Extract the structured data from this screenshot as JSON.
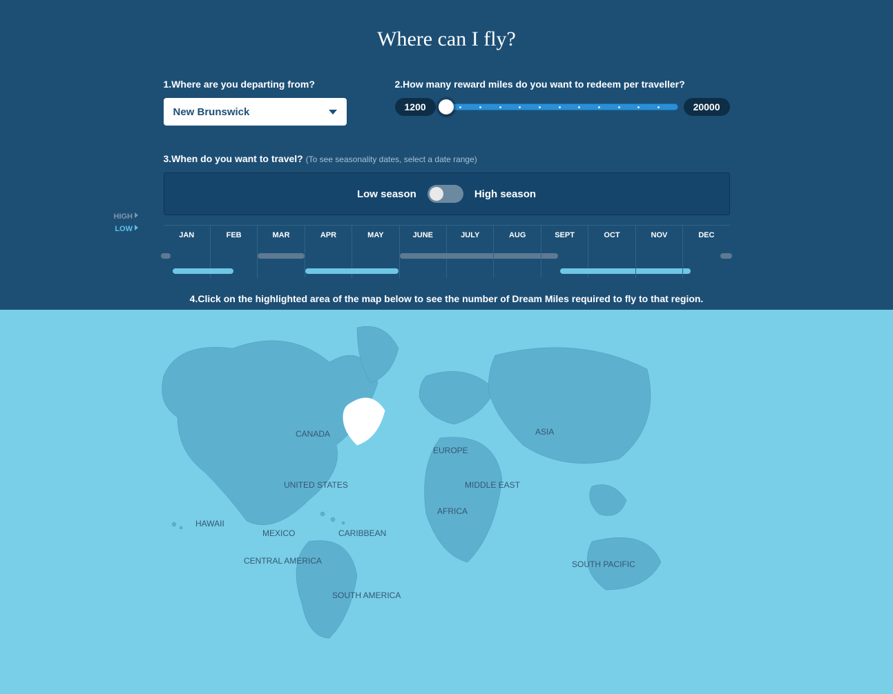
{
  "title": "Where can I fly?",
  "q1": {
    "label": "1.Where are you departing from?",
    "value": "New Brunswick"
  },
  "q2": {
    "label": "2.How many reward miles do you want to redeem per traveller?",
    "min": "1200",
    "max": "20000"
  },
  "q3": {
    "label": "3.When do you want to travel?",
    "sublabel": "(To see seasonality dates, select a date range)",
    "low": "Low season",
    "high": "High season",
    "legend_high": "HIGH",
    "legend_low": "LOW",
    "months": [
      "JAN",
      "FEB",
      "MAR",
      "APR",
      "MAY",
      "JUNE",
      "JULY",
      "AUG",
      "SEPT",
      "OCT",
      "NOV",
      "DEC"
    ]
  },
  "q4": {
    "label": "4.Click on the highlighted area of the map below to see the number of Dream Miles required to fly to that region."
  },
  "map": {
    "regions": {
      "canada": "CANADA",
      "united_states": "UNITED STATES",
      "hawaii": "HAWAII",
      "mexico": "MEXICO",
      "central_america": "CENTRAL AMERICA",
      "caribbean": "CARIBBEAN",
      "south_america": "SOUTH AMERICA",
      "europe": "EUROPE",
      "middle_east": "MIDDLE EAST",
      "africa": "AFRICA",
      "asia": "ASIA",
      "south_pacific": "SOUTH PACIFIC"
    }
  }
}
